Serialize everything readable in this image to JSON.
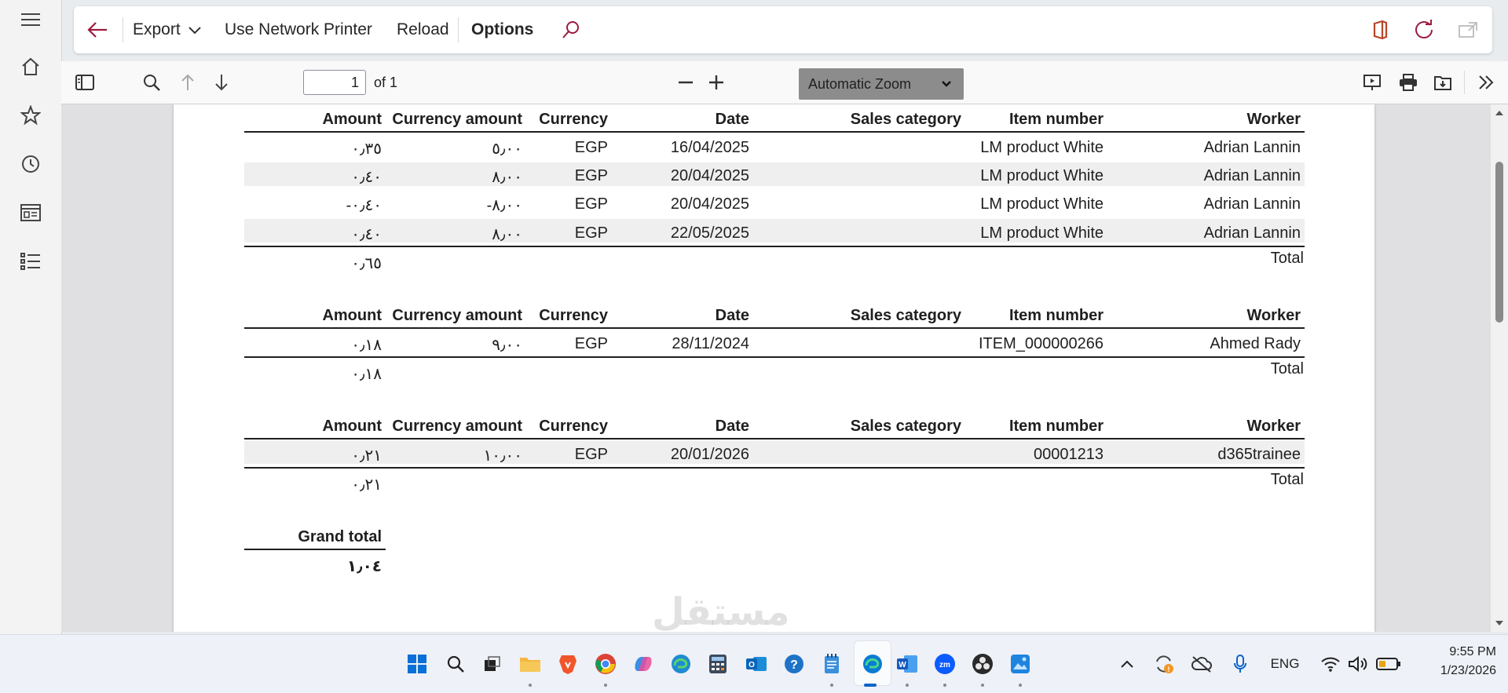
{
  "nav_rail": {
    "items": [
      "menu-icon",
      "home-icon",
      "star-icon",
      "clock-icon",
      "workspace-icon",
      "list-icon"
    ]
  },
  "toolbar": {
    "export_label": "Export",
    "network_printer_label": "Use Network Printer",
    "reload_label": "Reload",
    "options_label": "Options"
  },
  "pdf_toolbar": {
    "page_number": "1",
    "page_of": "of 1",
    "zoom_label": "Automatic Zoom"
  },
  "report": {
    "headers": {
      "amount": "Amount",
      "currency_amount": "Currency amount",
      "currency": "Currency",
      "date": "Date",
      "sales_category": "Sales category",
      "item_number": "Item number",
      "worker": "Worker"
    },
    "total_label": "Total",
    "grand_total_label": "Grand total",
    "grand_total_value": "١٫٠٤",
    "groups": [
      {
        "rows": [
          {
            "amount": "٠٫٣٥",
            "currency_amount": "٥٫٠٠",
            "currency": "EGP",
            "date": "16/04/2025",
            "sales_category": "",
            "item_number": "LM product White",
            "worker": "Adrian Lannin"
          },
          {
            "amount": "٠٫٤٠",
            "currency_amount": "٨٫٠٠",
            "currency": "EGP",
            "date": "20/04/2025",
            "sales_category": "",
            "item_number": "LM product White",
            "worker": "Adrian Lannin"
          },
          {
            "amount": "-٠٫٤٠",
            "currency_amount": "-٨٫٠٠",
            "currency": "EGP",
            "date": "20/04/2025",
            "sales_category": "",
            "item_number": "LM product White",
            "worker": "Adrian Lannin"
          },
          {
            "amount": "٠٫٤٠",
            "currency_amount": "٨٫٠٠",
            "currency": "EGP",
            "date": "22/05/2025",
            "sales_category": "",
            "item_number": "LM product White",
            "worker": "Adrian Lannin"
          }
        ],
        "total": "٠٫٦٥"
      },
      {
        "rows": [
          {
            "amount": "٠٫١٨",
            "currency_amount": "٩٫٠٠",
            "currency": "EGP",
            "date": "28/11/2024",
            "sales_category": "",
            "item_number": "ITEM_000000266",
            "worker": "Ahmed Rady"
          }
        ],
        "total": "٠٫١٨"
      },
      {
        "rows": [
          {
            "amount": "٠٫٢١",
            "currency_amount": "١٠٫٠٠",
            "currency": "EGP",
            "date": "20/01/2026",
            "sales_category": "",
            "item_number": "00001213",
            "worker": "d365trainee"
          }
        ],
        "total": "٠٫٢١"
      }
    ]
  },
  "watermark": "مستقل",
  "taskbar": {
    "language": "ENG",
    "time": "9:55 PM",
    "date": "1/23/2026"
  },
  "colors": {
    "accent": "#9b1b3f",
    "toolbar_bg": "#ffffff",
    "band": "#efefef",
    "zoom_select": "#8c8c8c"
  }
}
